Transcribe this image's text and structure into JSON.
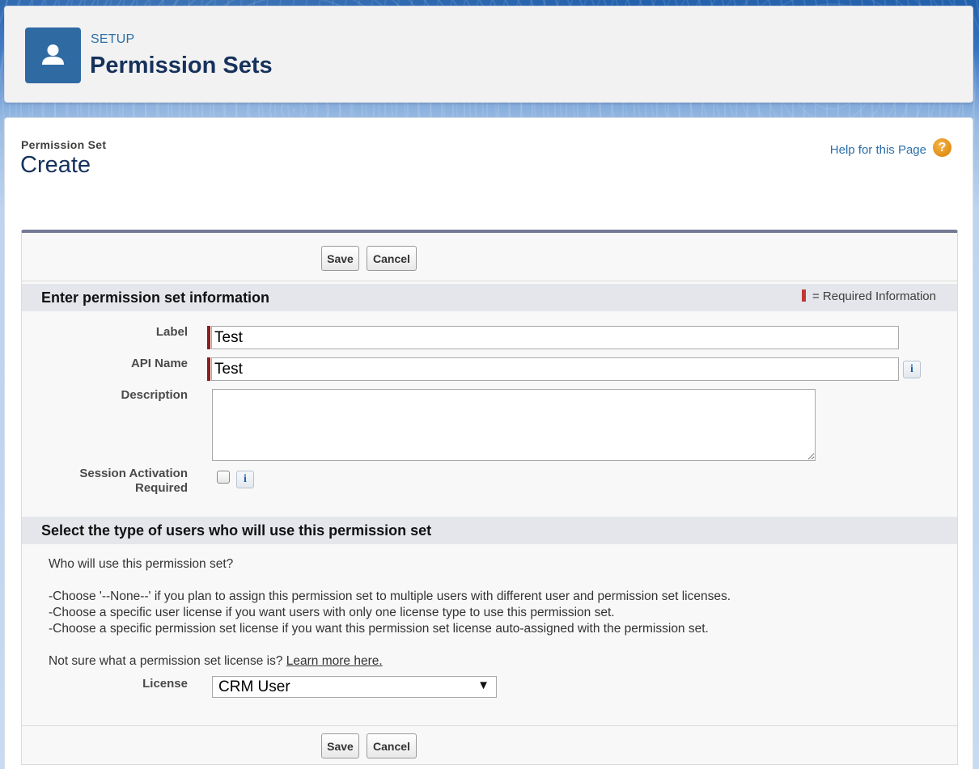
{
  "header": {
    "eyebrow": "SETUP",
    "title": "Permission Sets",
    "icon": "user-icon"
  },
  "page": {
    "type_label": "Permission Set",
    "heading": "Create",
    "help_link": "Help for this Page",
    "help_icon": "question-icon"
  },
  "buttons": {
    "save": "Save",
    "cancel": "Cancel"
  },
  "section1": {
    "title": "Enter permission set information",
    "required_legend": "= Required Information",
    "fields": {
      "label": {
        "label": "Label",
        "value": "Test"
      },
      "api_name": {
        "label": "API Name",
        "value": "Test"
      },
      "description": {
        "label": "Description",
        "value": ""
      },
      "session_activation": {
        "label_line1": "Session Activation",
        "label_line2": "Required",
        "checked": false
      }
    },
    "info_glyph": "i"
  },
  "section2": {
    "title": "Select the type of users who will use this permission set",
    "question": "Who will use this permission set?",
    "bullets": [
      "-Choose '--None--' if you plan to assign this permission set to multiple users with different user and permission set licenses.",
      "-Choose a specific user license if you want users with only one license type to use this permission set.",
      "-Choose a specific permission set license if you want this permission set license auto-assigned with the permission set."
    ],
    "not_sure": "Not sure what a permission set license is?",
    "learn_more": "Learn more here.",
    "license_label": "License",
    "license_value": "CRM User",
    "dropdown_arrow": "▼"
  },
  "colors": {
    "brand_blue": "#2f6aa3",
    "required_red": "#8e1d1d",
    "help_orange": "#e08f17"
  }
}
